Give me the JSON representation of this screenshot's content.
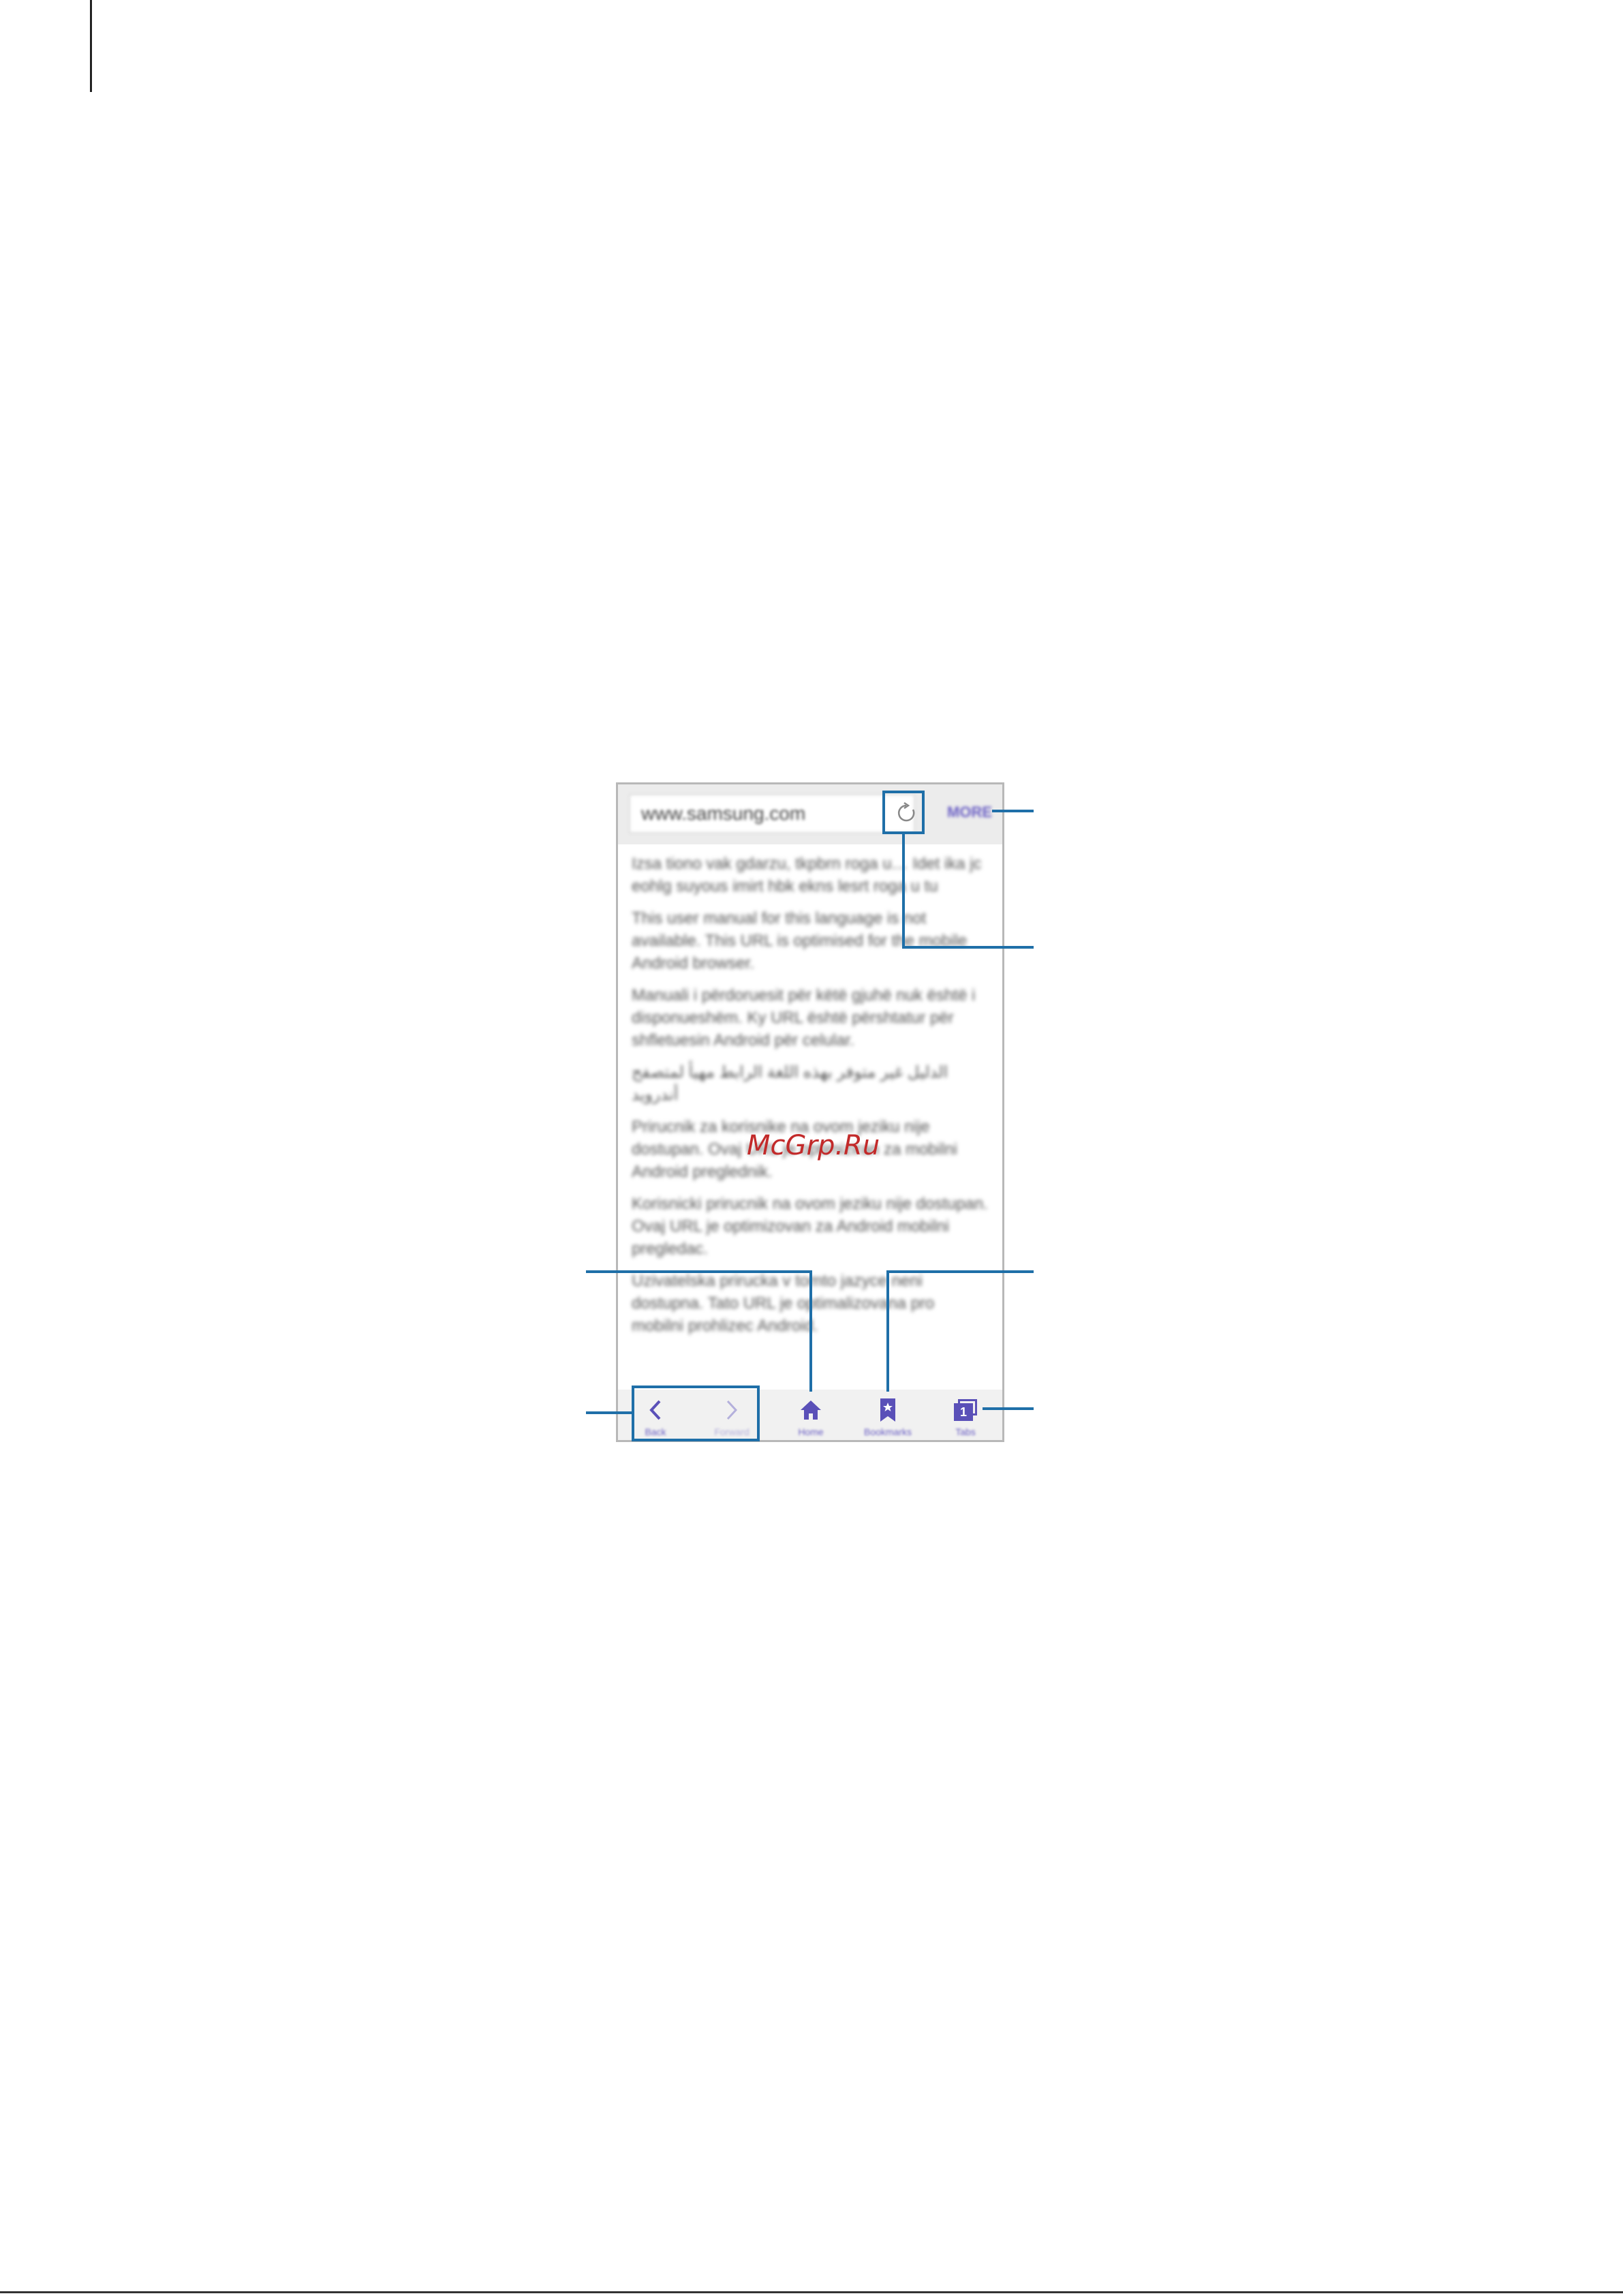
{
  "browser": {
    "url": "www.samsung.com",
    "more_label": "MORE",
    "content": [
      "Izsa tiono vak gdarzu, tkpbrn roga u… Idet ika jc eohlg suyous imirt hbk ekns lesrt roga u tu",
      "This user manual for this language is not available. This URL is optimised for the mobile Android browser.",
      "Manuali i përdoruesit për këtë gjuhë nuk është i disponueshëm. Ky URL është përshtatur për shfletuesin Android për celular.",
      "الدليل غير متوفر بهذه اللغة الرابط مهيأ لمتصفح أندرويد",
      "Prirucnik za korisnike na ovom jeziku nije dostupan. Ovaj URL je optimiziran za mobilni Android preglednik.",
      "Korisnicki prirucnik na ovom jeziku nije dostupan. Ovaj URL je optimizovan za Android mobilni pregledac.",
      "Uzivatelska prirucka v tomto jazyce neni dostupna. Tato URL je optimalizovana pro mobilni prohlizec Android."
    ],
    "nav": {
      "back": "Back",
      "forward": "Forward",
      "home": "Home",
      "bookmarks": "Bookmarks",
      "tabs": "Tabs",
      "tab_count": "1"
    }
  },
  "watermark": "McGrp.Ru",
  "colors": {
    "accent": "#6b60c4",
    "callout": "#1f6fa8"
  }
}
